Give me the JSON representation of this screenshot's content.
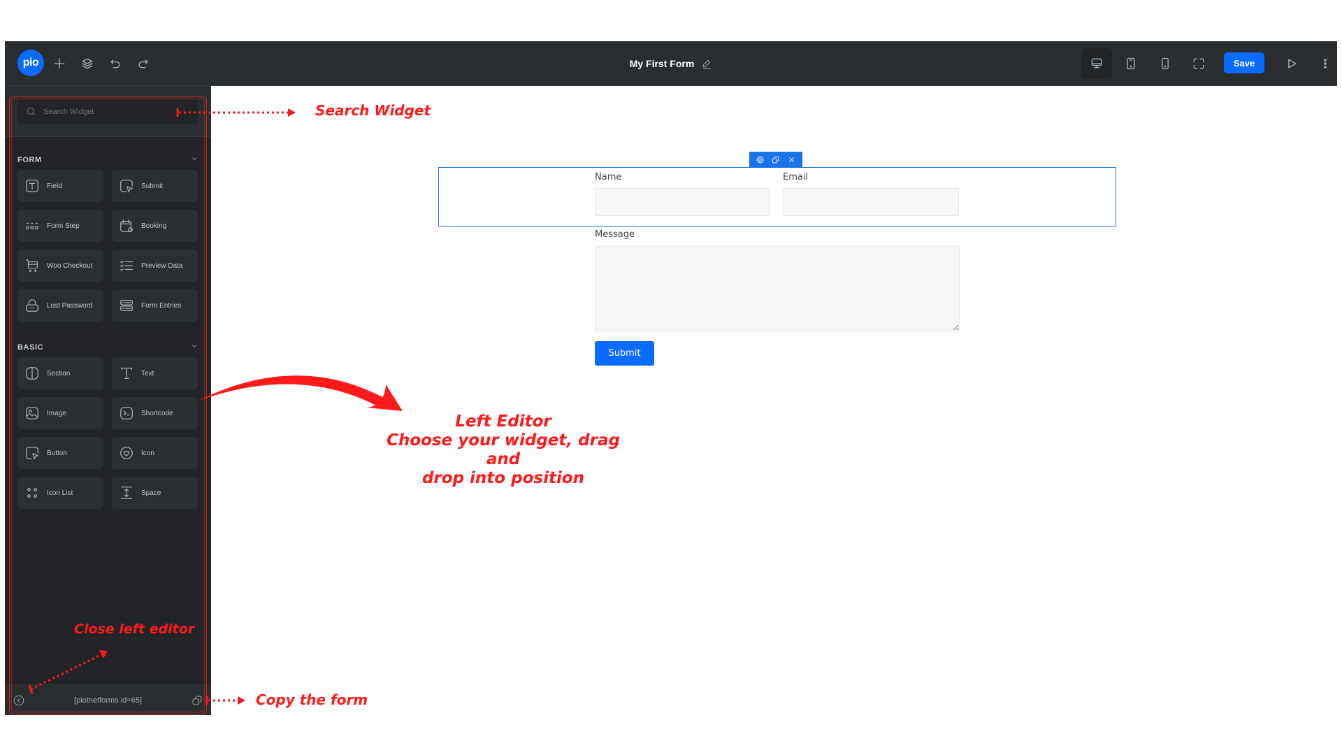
{
  "header": {
    "logo_text": "pio",
    "title": "My First Form",
    "save_label": "Save",
    "icons": [
      "plus-icon",
      "layers-icon",
      "undo-icon",
      "redo-icon",
      "desktop-icon",
      "tablet-icon",
      "mobile-icon",
      "fullscreen-icon",
      "preview-play-icon",
      "more-vertical-icon"
    ],
    "active_device": "desktop"
  },
  "sidebar": {
    "search_placeholder": "Search Widget",
    "groups": [
      {
        "title": "FORM",
        "items": [
          {
            "label": "Field",
            "icon": "text-field-icon"
          },
          {
            "label": "Submit",
            "icon": "submit-cursor-icon"
          },
          {
            "label": "Form Step",
            "icon": "form-step-icon"
          },
          {
            "label": "Booking",
            "icon": "calendar-booking-icon"
          },
          {
            "label": "Woo Checkout",
            "icon": "cart-icon"
          },
          {
            "label": "Preview Data",
            "icon": "checklist-icon"
          },
          {
            "label": "Lost Password",
            "icon": "lock-icon"
          },
          {
            "label": "Form Entries",
            "icon": "entries-icon"
          }
        ]
      },
      {
        "title": "BASIC",
        "items": [
          {
            "label": "Section",
            "icon": "section-columns-icon"
          },
          {
            "label": "Text",
            "icon": "text-icon"
          },
          {
            "label": "Image",
            "icon": "image-icon"
          },
          {
            "label": "Shortcode",
            "icon": "terminal-icon"
          },
          {
            "label": "Button",
            "icon": "button-cursor-icon"
          },
          {
            "label": "Icon",
            "icon": "heart-circle-icon"
          },
          {
            "label": "Icon List",
            "icon": "icon-list-icon"
          },
          {
            "label": "Space",
            "icon": "space-icon"
          }
        ]
      }
    ],
    "shortcode": "[piotnetforms id=65]"
  },
  "form": {
    "fields": [
      {
        "label": "Name",
        "value": ""
      },
      {
        "label": "Email",
        "value": ""
      },
      {
        "label": "Message",
        "value": ""
      }
    ],
    "submit_label": "Submit"
  },
  "annotations": {
    "search": "Search Widget",
    "left_editor_title": "Left Editor",
    "left_editor_line1": "Choose your widget, drag and",
    "left_editor_line2": "drop into position",
    "close_editor": "Close left editor",
    "copy_form": "Copy the form",
    "color": "#ff1a1a"
  },
  "colors": {
    "accent": "#0a6cff",
    "selection": "#1a73e8",
    "topbar": "#2b2e30",
    "sidebar": "#222427"
  }
}
